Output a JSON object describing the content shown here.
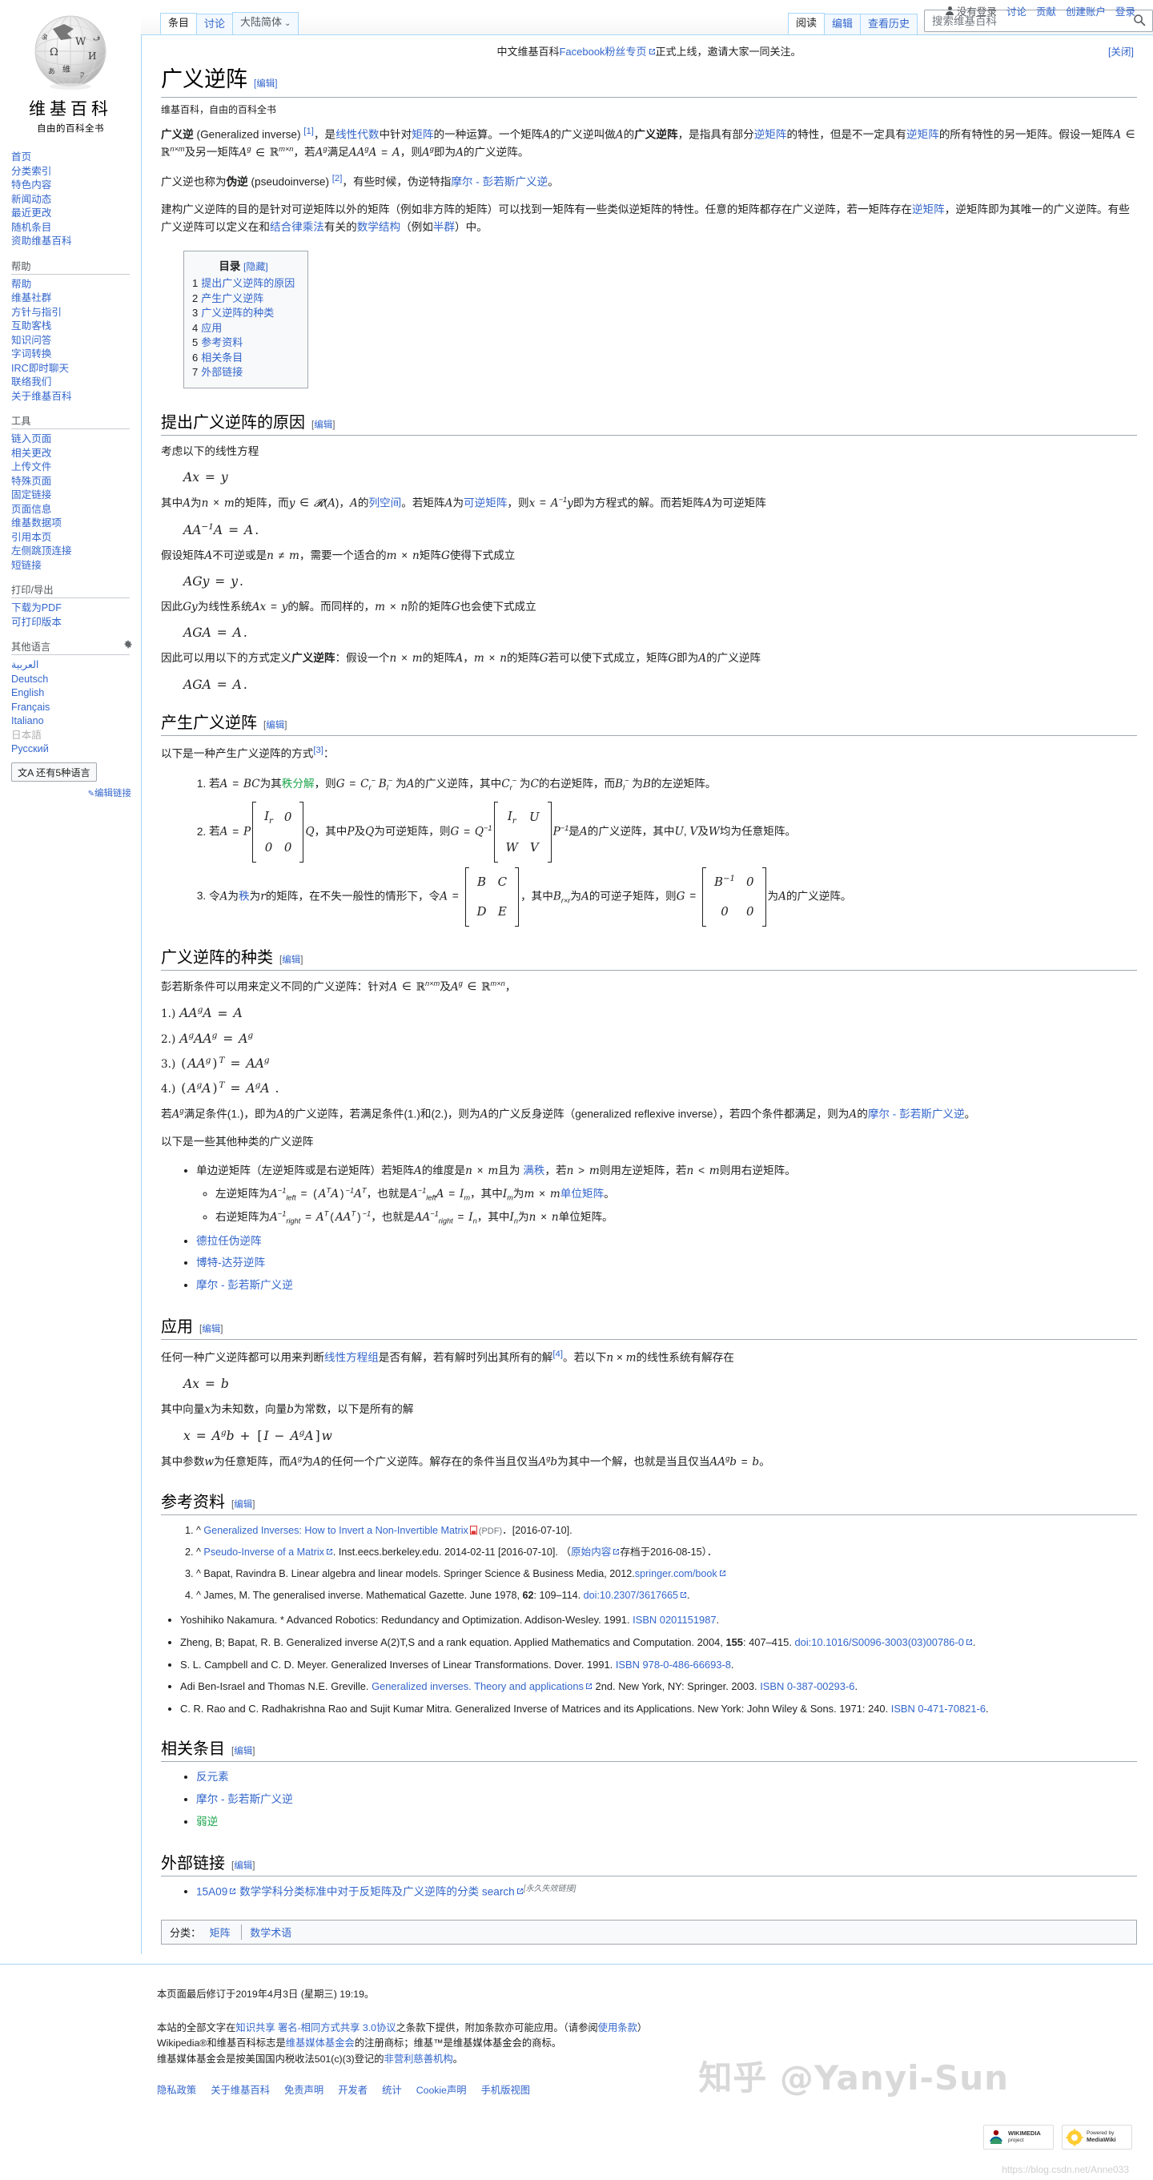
{
  "personal": {
    "anon_label": "没有登录",
    "items": [
      "讨论",
      "贡献",
      "创建账户",
      "登录"
    ]
  },
  "brand": {
    "wordmark": "维基百科",
    "tagline": "自由的百科全书"
  },
  "sidebar": {
    "nav_items": [
      "首页",
      "分类索引",
      "特色内容",
      "新闻动态",
      "最近更改",
      "随机条目",
      "资助维基百科"
    ],
    "help": {
      "title": "帮助",
      "items": [
        "帮助",
        "维基社群",
        "方针与指引",
        "互助客栈",
        "知识问答",
        "字词转换",
        "IRC即时聊天",
        "联络我们",
        "关于维基百科"
      ]
    },
    "tools": {
      "title": "工具",
      "items": [
        "链入页面",
        "相关更改",
        "上传文件",
        "特殊页面",
        "固定链接",
        "页面信息",
        "维基数据项",
        "引用本页",
        "左侧跳顶连接",
        "短链接"
      ]
    },
    "print": {
      "title": "打印/导出",
      "items": [
        "下载为PDF",
        "可打印版本"
      ]
    },
    "languages": {
      "title": "其他语言",
      "items": [
        "العربية",
        "Deutsch",
        "English",
        "Français",
        "Italiano",
        "日本語",
        "Русский"
      ],
      "more_button": "文A 还有5种语言",
      "edit_links": "编辑链接"
    }
  },
  "tabs": {
    "left": [
      {
        "label": "条目",
        "selected": true
      },
      {
        "label": "讨论",
        "selected": false
      },
      {
        "label": "大陆简体",
        "selected": false,
        "variant": true,
        "caret": "⌄"
      }
    ],
    "right": [
      {
        "label": "阅读",
        "selected": true
      },
      {
        "label": "编辑",
        "selected": false
      },
      {
        "label": "查看历史",
        "selected": false
      }
    ]
  },
  "search": {
    "placeholder": "搜索维基百科",
    "value": ""
  },
  "sitenotice": {
    "text_before": "中文维基百科",
    "link": "Facebook粉丝专页",
    "text_after": "正式上线，邀请大家一同关注。",
    "close": "[关闭]"
  },
  "article": {
    "title": "广义逆阵",
    "edit_label": "[编辑]",
    "sitesub": "维基百科，自由的百科全书",
    "intro": {
      "p1_parts": [
        {
          "t": "广义逆",
          "b": true
        },
        {
          "t": " (Generalized inverse) "
        },
        {
          "t": "[1]",
          "ref": true
        },
        {
          "t": "，是"
        },
        {
          "t": "线性代数",
          "link": true
        },
        {
          "t": "中针对"
        },
        {
          "t": "矩阵",
          "link": true
        },
        {
          "t": "的一种运算。一个矩阵"
        },
        {
          "t": "A",
          "math": true
        },
        {
          "t": "的广义逆叫做"
        },
        {
          "t": "A",
          "math": true
        },
        {
          "t": "的"
        },
        {
          "t": "广义逆阵",
          "b": true
        },
        {
          "t": "，是指具有部分"
        },
        {
          "t": "逆矩阵",
          "link": true
        },
        {
          "t": "的特性，但是不一定具有"
        },
        {
          "t": "逆矩阵",
          "link": true
        },
        {
          "t": "的所有特性的另一矩阵。假设一矩阵"
        },
        {
          "t": "A ∈ ℝ",
          "math": true
        },
        {
          "t": "n×m",
          "sup": true
        },
        {
          "t": "及另一矩阵"
        },
        {
          "t": "A",
          "math": true
        },
        {
          "t": "g",
          "sup": true
        },
        {
          "t": " ∈ ℝ",
          "math": true
        },
        {
          "t": "m×n",
          "sup": true
        },
        {
          "t": "，若"
        },
        {
          "t": "A",
          "math": true
        },
        {
          "t": "g",
          "sup": true
        },
        {
          "t": "满足"
        },
        {
          "t": "AAᵍA = A",
          "math": true
        },
        {
          "t": "，则"
        },
        {
          "t": "A",
          "math": true
        },
        {
          "t": "g",
          "sup": true
        },
        {
          "t": "即为"
        },
        {
          "t": "A",
          "math": true
        },
        {
          "t": "的广义逆阵。"
        }
      ],
      "p2_parts": [
        {
          "t": "广义逆也称为"
        },
        {
          "t": "伪逆",
          "b": true
        },
        {
          "t": " (pseudoinverse) "
        },
        {
          "t": "[2]",
          "ref": true
        },
        {
          "t": "，有些时候，伪逆特指"
        },
        {
          "t": "摩尔 - 彭若斯广义逆",
          "link": true
        },
        {
          "t": "。"
        }
      ],
      "p3": "建构广义逆阵的目的是针对可逆矩阵以外的矩阵（例如非方阵的矩阵）可以找到一矩阵有一些类似逆矩阵的特性。任意的矩阵都存在广义逆阵，若一矩阵存在逆矩阵，逆矩阵即为其唯一的广义逆阵。有些广义逆阵可以定义在和结合律乘法有关的数学结构（例如半群）中。",
      "p3_links": [
        "逆矩阵",
        "结合律乘法",
        "数学结构",
        "半群"
      ]
    },
    "toc": {
      "title": "目录",
      "toggle": "[隐藏]",
      "items": [
        {
          "n": "1",
          "text": "提出广义逆阵的原因"
        },
        {
          "n": "2",
          "text": "产生广义逆阵"
        },
        {
          "n": "3",
          "text": "广义逆阵的种类"
        },
        {
          "n": "4",
          "text": "应用"
        },
        {
          "n": "5",
          "text": "参考资料"
        },
        {
          "n": "6",
          "text": "相关条目"
        },
        {
          "n": "7",
          "text": "外部链接"
        }
      ]
    },
    "sections": {
      "s1": {
        "heading": "提出广义逆阵的原因",
        "p1": "考虑以下的线性方程",
        "eq1": "Ax = y",
        "p2_a": "其中",
        "p2_full": "其中A为n × m的矩阵，而y ∈ 𝓡(A)，A的列空间。若矩阵A为可逆矩阵，则x = A⁻¹y即为方程式的解。而若矩阵A为可逆矩阵",
        "eq2": "AA⁻¹A = A.",
        "p3": "假设矩阵A不可逆或是n ≠ m，需要一个适合的m × n矩阵G使得下式成立",
        "eq3": "AGy = y.",
        "p4": "因此Gy为线性系统Ax = y的解。而同样的，m × n阶的矩阵G也会使下式成立",
        "eq4": "AGA = A.",
        "p5": "因此可以用以下的方式定义广义逆阵：假设一个n × m的矩阵A，m × n的矩阵G若可以使下式成立，矩阵G即为A的广义逆阵",
        "eq5": "AGA = A."
      },
      "s2": {
        "heading": "产生广义逆阵",
        "lead": "以下是一种产生广义逆阵的方式",
        "lead_ref": "[3]",
        "lead_colon": "：",
        "item1": "若A = BC为其秩分解，则G = C⁻ᵣB⁻ₗ 为A的广义逆阵，其中C⁻ᵣ 为C的右逆矩阵，而B⁻ₗ 为B的左逆矩阵。",
        "item1_link": "秩分解",
        "item2_a": "若A = P",
        "item2_b": "Q，其中P及Q为可逆矩阵，则G = Q⁻¹",
        "item2_c": "P⁻¹是A的广义逆阵，其中U, V及W均为任意矩阵。",
        "item3_a": "令A为秩为r的矩阵，在不失一般性的情形下，令A =",
        "item3_b": "，其中B_{r×r}为A的可逆子矩阵，则G =",
        "item3_c": "为A的广义逆阵。",
        "item3_link": "秩"
      },
      "s3": {
        "heading": "广义逆阵的种类",
        "lead": "彭若斯条件可以用来定义不同的广义逆阵：针对A ∈ ℝⁿˣᵐ及Aᵍ ∈ ℝᵐˣⁿ，",
        "conditions": [
          {
            "n": "1.)",
            "eq": "AAᵍA = A"
          },
          {
            "n": "2.)",
            "eq": "AᵍAAᵍ = Aᵍ"
          },
          {
            "n": "3.)",
            "eq": "(AAᵍ)ᵀ = AAᵍ"
          },
          {
            "n": "4.)",
            "eq": "(AᵍA)ᵀ = AᵍA ."
          }
        ],
        "p_after": "若Aᵍ满足条件(1.)，即为A的广义逆阵，若满足条件(1.)和(2.)，则为A的广义反身逆阵（generalized reflexive inverse），若四个条件都满足，则为A的摩尔 - 彭若斯广义逆。",
        "p_after_link": "摩尔 - 彭若斯广义逆",
        "p_others": "以下是一些其他种类的广义逆阵",
        "bullets": [
          {
            "text": "单边逆矩阵（左逆矩阵或是右逆矩阵）若矩阵A的维度是n × m且为 满秩，若n > m则用左逆矩阵，若n < m则用右逆矩阵。",
            "link": "满秩",
            "sub": [
              "左逆矩阵为A⁻¹ₗₑ𝒻ₜ = (AᵀA)⁻¹Aᵀ，也就是A⁻¹ₗₑ𝒻ₜA = Iₘ，其中Iₘ为m × m单位矩阵。",
              "右逆矩阵为A⁻¹ᵣᵢgₕₜ = Aᵀ(AAᵀ)⁻¹，也就是AA⁻¹ᵣᵢgₕₜ = Iₙ，其中Iₙ为n × n单位矩阵。"
            ],
            "sub_links": [
              "单位矩阵",
              "单位矩阵"
            ]
          },
          {
            "text": "德拉任伪逆阵",
            "islink": true
          },
          {
            "text": "博特-达芬逆阵",
            "islink": true
          },
          {
            "text": "摩尔 - 彭若斯广义逆",
            "islink": true
          }
        ]
      },
      "s4": {
        "heading": "应用",
        "p1": "任何一种广义逆阵都可以用来判断线性方程组是否有解，若有解时列出其所有的解",
        "p1_ref": "[4]",
        "p1_b": "。若以下n × m的线性系统有解存在",
        "p1_link": "线性方程组",
        "eq1": "Ax = b",
        "p2": "其中向量x为未知数，向量b为常数，以下是所有的解",
        "eq2": "x = Aᵍb + [I − AᵍA]w",
        "p3": "其中参数w为任意矩阵，而Aᵍ为A的任何一个广义逆阵。解存在的条件当且仅当Aᵍb为其中一个解，也就是当且仅当AAᵍb = b。"
      },
      "s5": {
        "heading": "参考资料",
        "numbered": [
          {
            "n": "1.",
            "caret": "^",
            "link": "Generalized Inverses: How to Invert a Non-Invertible Matrix",
            "pdf": true,
            "pdf_label": "(PDF)",
            "rest": "[2016-07-10]."
          },
          {
            "n": "2.",
            "caret": "^",
            "link": "Pseudo-Inverse of a Matrix",
            "rest": ". Inst.eecs.berkeley.edu. 2014-02-11 [2016-07-10]. （",
            "link2": "原始内容",
            "rest2": "存档于2016-08-15）．"
          },
          {
            "n": "3.",
            "caret": "^",
            "plain": "Bapat, Ravindra B. Linear algebra and linear models. Springer Science & Business Media, 2012.",
            "link": "springer.com/book"
          },
          {
            "n": "4.",
            "caret": "^",
            "plain": "James, M. The generalised inverse. Mathematical Gazette. June 1978, ",
            "bold": "62",
            "plain2": ": 109–114. ",
            "link": "doi:10.2307/3617665",
            "rest": "."
          }
        ],
        "bulleted": [
          {
            "plain": "Yoshihiko Nakamura. * Advanced Robotics: Redundancy and Optimization. Addison-Wesley. 1991. ",
            "link": "ISBN 0201151987",
            "rest": "."
          },
          {
            "plain": "Zheng, B; Bapat, R. B. Generalized inverse A(2)T,S and a rank equation. Applied Mathematics and Computation. 2004, ",
            "bold": "155",
            "plain2": ": 407–415. ",
            "link": "doi:10.1016/S0096-3003(03)00786-0",
            "rest": "."
          },
          {
            "plain": "S. L. Campbell and C. D. Meyer. Generalized Inverses of Linear Transformations. Dover. 1991. ",
            "link": "ISBN 978-0-486-66693-8",
            "rest": "."
          },
          {
            "plain": "Adi Ben-Israel and Thomas N.E. Greville. ",
            "link": "Generalized inverses. Theory and applications",
            "plain2": " 2nd. New York, NY: Springer. 2003. ",
            "link2": "ISBN 0-387-00293-6",
            "rest": "."
          },
          {
            "plain": "C. R. Rao and C. Radhakrishna Rao and Sujit Kumar Mitra. Generalized Inverse of Matrices and its Applications. New York: John Wiley & Sons. 1971: 240. ",
            "link": "ISBN 0-471-70821-6",
            "rest": "."
          }
        ]
      },
      "s6": {
        "heading": "相关条目",
        "items": [
          "反元素",
          "摩尔 - 彭若斯广义逆",
          "弱逆"
        ],
        "new_index": 2
      },
      "s7": {
        "heading": "外部链接",
        "item_link1": "15A09",
        "item_link2": "数学学科分类标准中对于反矩阵及广义逆阵的分类 search",
        "item_note": "[永久失效链接]"
      }
    },
    "categories": {
      "label": "分类：",
      "items": [
        "矩阵",
        "数学术语"
      ]
    }
  },
  "footer": {
    "lastmod": "本页面最后修订于2019年4月3日 (星期三) 19:19。",
    "license_a": "本站的全部文字在",
    "license_link": "知识共享 署名-相同方式共享 3.0协议",
    "license_b": "之条款下提供，附加条款亦可能应用。（请参阅",
    "license_link2": "使用条款",
    "license_c": "）",
    "tm_a": "Wikipedia®和维基百科标志是",
    "tm_link": "维基媒体基金会",
    "tm_b": "的注册商标；维基™是维基媒体基金会的商标。",
    "np_a": "维基媒体基金会是按美国国内税收法501(c)(3)登记的",
    "np_link": "非营利慈善机构",
    "np_b": "。",
    "places": [
      "隐私政策",
      "关于维基百科",
      "免责声明",
      "开发者",
      "统计",
      "Cookie声明",
      "手机版视图"
    ],
    "badges": [
      {
        "name": "WIKIMEDIA",
        "sub": "project"
      },
      {
        "name": "MediaWiki",
        "sub": "Powered by"
      }
    ]
  },
  "watermark": {
    "text": "知乎 @Yanyi-Sun",
    "url": "https://blog.csdn.net/Anne033"
  },
  "colors": {
    "link": "#3366cc",
    "newlink": "#1ca64c",
    "border": "#a7d7f9",
    "bg": "#ffffff",
    "panel_text": "#54595d"
  }
}
